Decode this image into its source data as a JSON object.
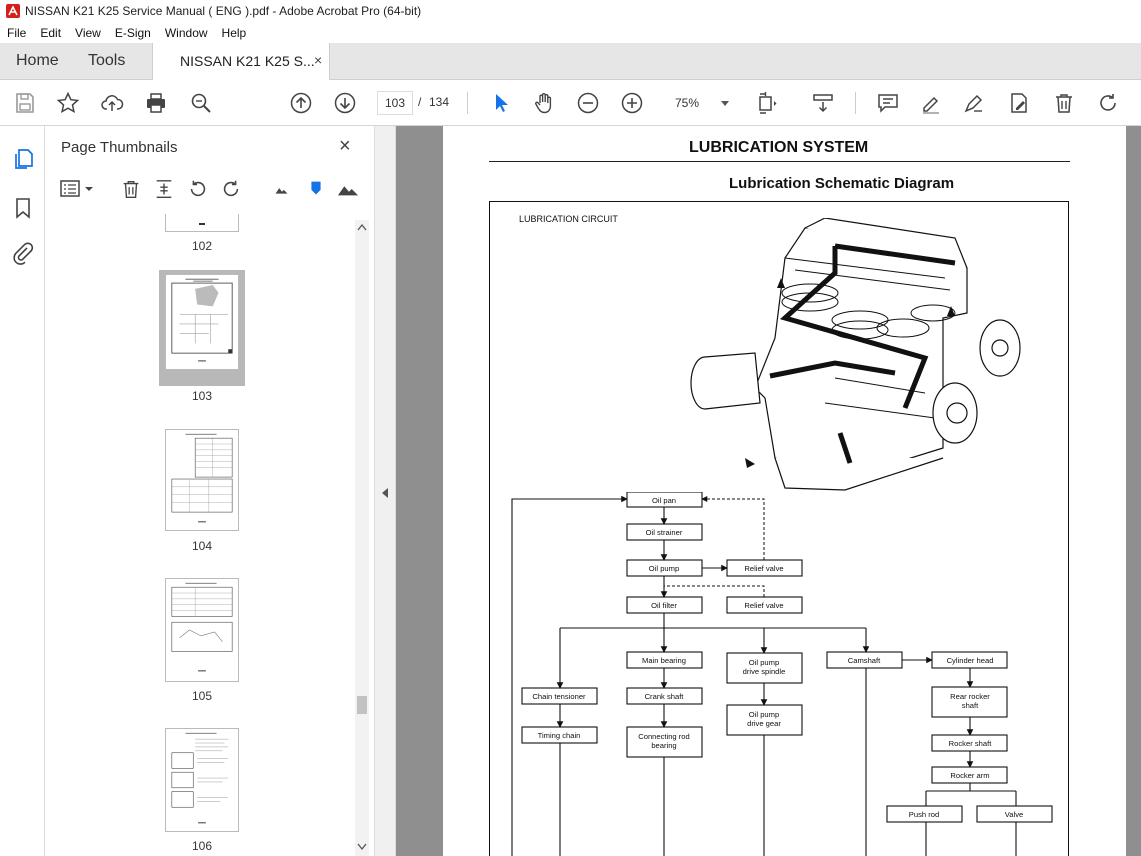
{
  "window": {
    "title": "NISSAN K21 K25 Service Manual ( ENG ).pdf - Adobe Acrobat Pro (64-bit)"
  },
  "menu": [
    "File",
    "Edit",
    "View",
    "E-Sign",
    "Window",
    "Help"
  ],
  "tabs": {
    "home": "Home",
    "tools": "Tools",
    "document": "NISSAN K21 K25 S...",
    "close": "×"
  },
  "toolbar": {
    "page_current": "103",
    "page_sep": "/",
    "page_total": "134",
    "zoom": "75%"
  },
  "panel": {
    "title": "Page Thumbnails",
    "close": "×",
    "thumbnails": [
      {
        "label": "102"
      },
      {
        "label": "103",
        "selected": true
      },
      {
        "label": "104"
      },
      {
        "label": "105"
      },
      {
        "label": "106"
      }
    ]
  },
  "document": {
    "heading": "LUBRICATION SYSTEM",
    "subheading": "Lubrication Schematic Diagram",
    "circuit_label": "LUBRICATION CIRCUIT",
    "boxes": {
      "oil_pan": "Oil pan",
      "oil_strainer": "Oil strainer",
      "oil_pump": "Oil pump",
      "relief_valve_1": "Relief valve",
      "oil_filter": "Oil filter",
      "relief_valve_2": "Relief valve",
      "main_bearing": "Main bearing",
      "oil_pump_drive_spindle_1": "Oil pump",
      "oil_pump_drive_spindle_2": "drive spindle",
      "camshaft": "Camshaft",
      "cylinder_head": "Cylinder head",
      "chain_tensioner": "Chain tensioner",
      "crank_shaft": "Crank shaft",
      "rear_rocker_shaft_1": "Rear rocker",
      "rear_rocker_shaft_2": "shaft",
      "timing_chain": "Timing chain",
      "connecting_rod_bearing_1": "Connecting rod",
      "connecting_rod_bearing_2": "bearing",
      "oil_pump_drive_gear_1": "Oil pump",
      "oil_pump_drive_gear_2": "drive gear",
      "rocker_shaft": "Rocker shaft",
      "rocker_arm": "Rocker arm",
      "push_rod": "Push rod",
      "valve": "Valve"
    }
  }
}
